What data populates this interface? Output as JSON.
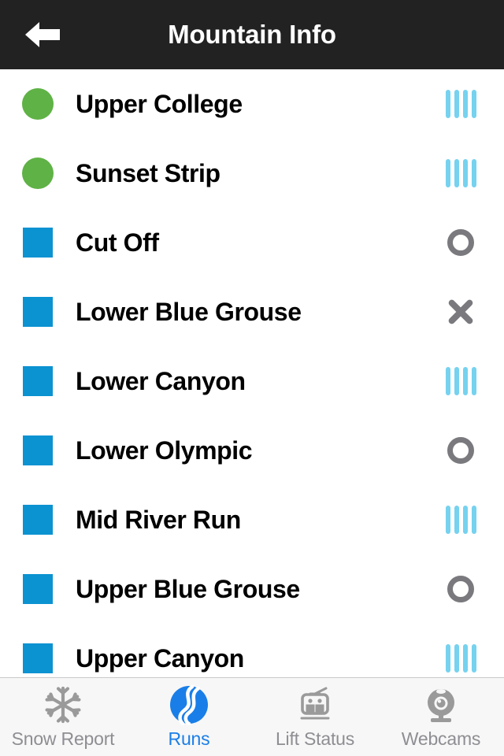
{
  "header": {
    "title": "Mountain Info",
    "back_icon": "arrow-left-icon",
    "background_color": "#222222",
    "text_color": "#ffffff"
  },
  "legend": {
    "green_circle": "easy",
    "blue_square": "intermediate",
    "groomed": "groomed",
    "open": "open",
    "closed": "closed"
  },
  "colors": {
    "easy_green": "#5fb245",
    "intermediate_blue": "#0b92d1",
    "groomed_blue": "#76d2ef",
    "status_gray": "#7a7a7e",
    "active_tab_blue": "#1a7ee8",
    "inactive_tab_gray": "#8e8e93"
  },
  "runs": [
    {
      "name": "Upper College",
      "difficulty": "green-circle",
      "status": "groomed"
    },
    {
      "name": "Sunset Strip",
      "difficulty": "green-circle",
      "status": "groomed"
    },
    {
      "name": "Cut Off",
      "difficulty": "blue-square",
      "status": "open"
    },
    {
      "name": "Lower Blue Grouse",
      "difficulty": "blue-square",
      "status": "closed"
    },
    {
      "name": "Lower Canyon",
      "difficulty": "blue-square",
      "status": "groomed"
    },
    {
      "name": "Lower Olympic",
      "difficulty": "blue-square",
      "status": "open"
    },
    {
      "name": "Mid River Run",
      "difficulty": "blue-square",
      "status": "groomed"
    },
    {
      "name": "Upper Blue Grouse",
      "difficulty": "blue-square",
      "status": "open"
    },
    {
      "name": "Upper Canyon",
      "difficulty": "blue-square",
      "status": "groomed"
    }
  ],
  "tabs": [
    {
      "label": "Snow Report",
      "icon": "snowflake-icon",
      "active": false
    },
    {
      "label": "Runs",
      "icon": "ski-tracks-icon",
      "active": true
    },
    {
      "label": "Lift Status",
      "icon": "gondola-icon",
      "active": false
    },
    {
      "label": "Webcams",
      "icon": "webcam-icon",
      "active": false
    }
  ]
}
